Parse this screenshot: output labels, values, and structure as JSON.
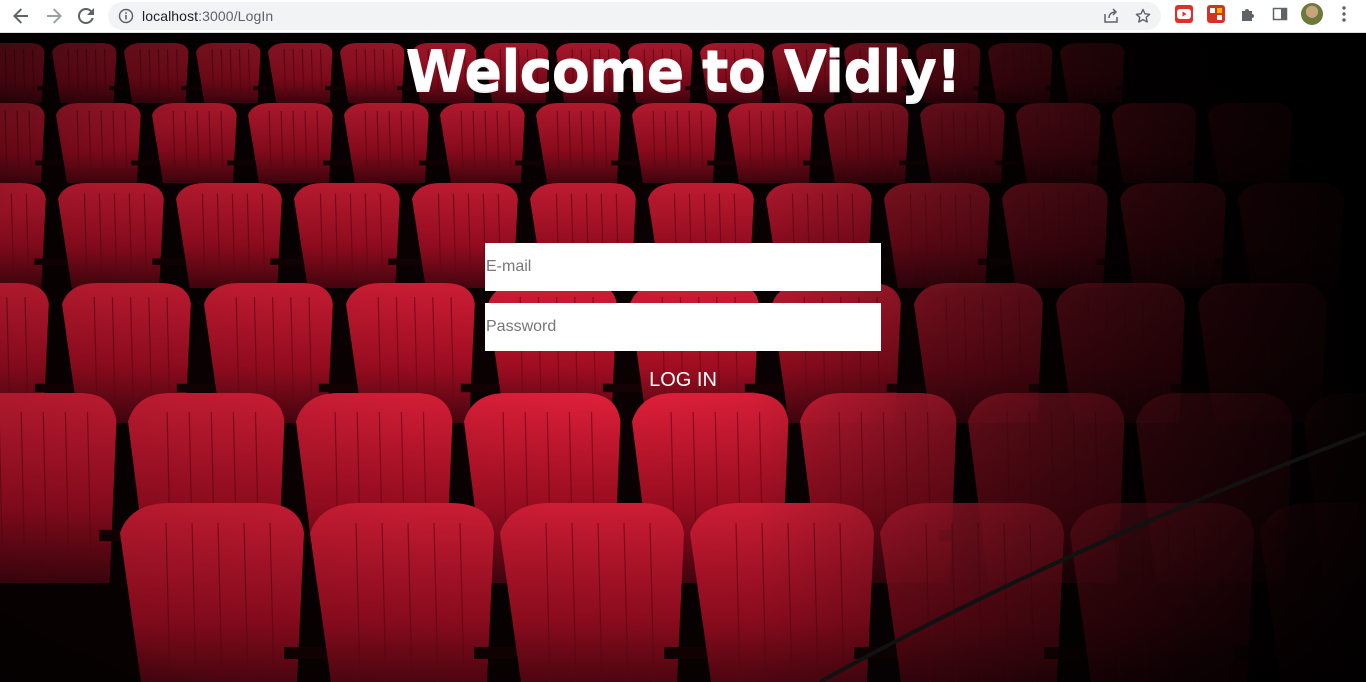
{
  "browser": {
    "url_host": "localhost",
    "url_path": ":3000/LogIn"
  },
  "page": {
    "title": "Welcome to Vidly!",
    "email_placeholder": "E-mail",
    "password_placeholder": "Password",
    "login_label": "LOG IN"
  },
  "colors": {
    "seat_red": "#c8102e",
    "background": "#050000",
    "text": "#ffffff"
  }
}
